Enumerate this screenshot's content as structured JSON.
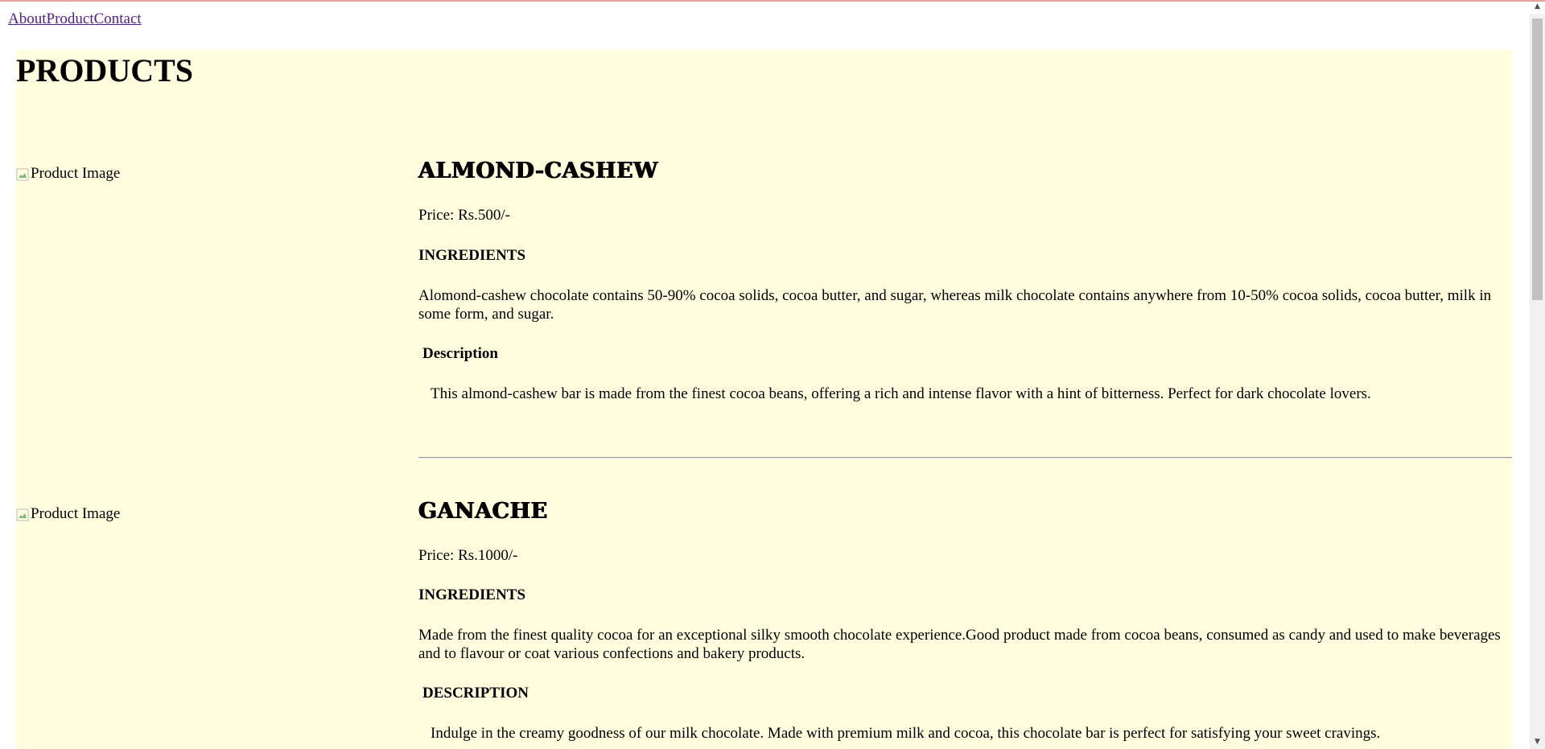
{
  "nav": {
    "about": "About",
    "product": "Product",
    "contact": "Contact"
  },
  "page": {
    "title": "PRODUCTS"
  },
  "products": [
    {
      "image_alt": "Product Image",
      "name": "ALMOND-CASHEW",
      "price": "Price: Rs.500/-",
      "ingredients_heading": "INGREDIENTS",
      "ingredients_text": "Alomond-cashew chocolate contains 50-90% cocoa solids, cocoa butter, and sugar, whereas milk chocolate contains anywhere from 10-50% cocoa solids, cocoa butter, milk in some form, and sugar.",
      "description_heading": "Description",
      "description_text": "This almond-cashew bar is made from the finest cocoa beans, offering a rich and intense flavor with a hint of bitterness. Perfect for dark chocolate lovers."
    },
    {
      "image_alt": "Product Image",
      "name": "GANACHE",
      "price": "Price: Rs.1000/-",
      "ingredients_heading": "INGREDIENTS",
      "ingredients_text": "Made from the finest quality cocoa for an exceptional silky smooth chocolate experience.Good product made from cocoa beans, consumed as candy and used to make beverages and to flavour or coat various confections and bakery products.",
      "description_heading": "DESCRIPTION",
      "description_text": "Indulge in the creamy goodness of our milk chocolate. Made with premium milk and cocoa, this chocolate bar is perfect for satisfying your sweet cravings."
    }
  ],
  "colors": {
    "content_background": "#ffffe0",
    "link": "#551a8b"
  }
}
